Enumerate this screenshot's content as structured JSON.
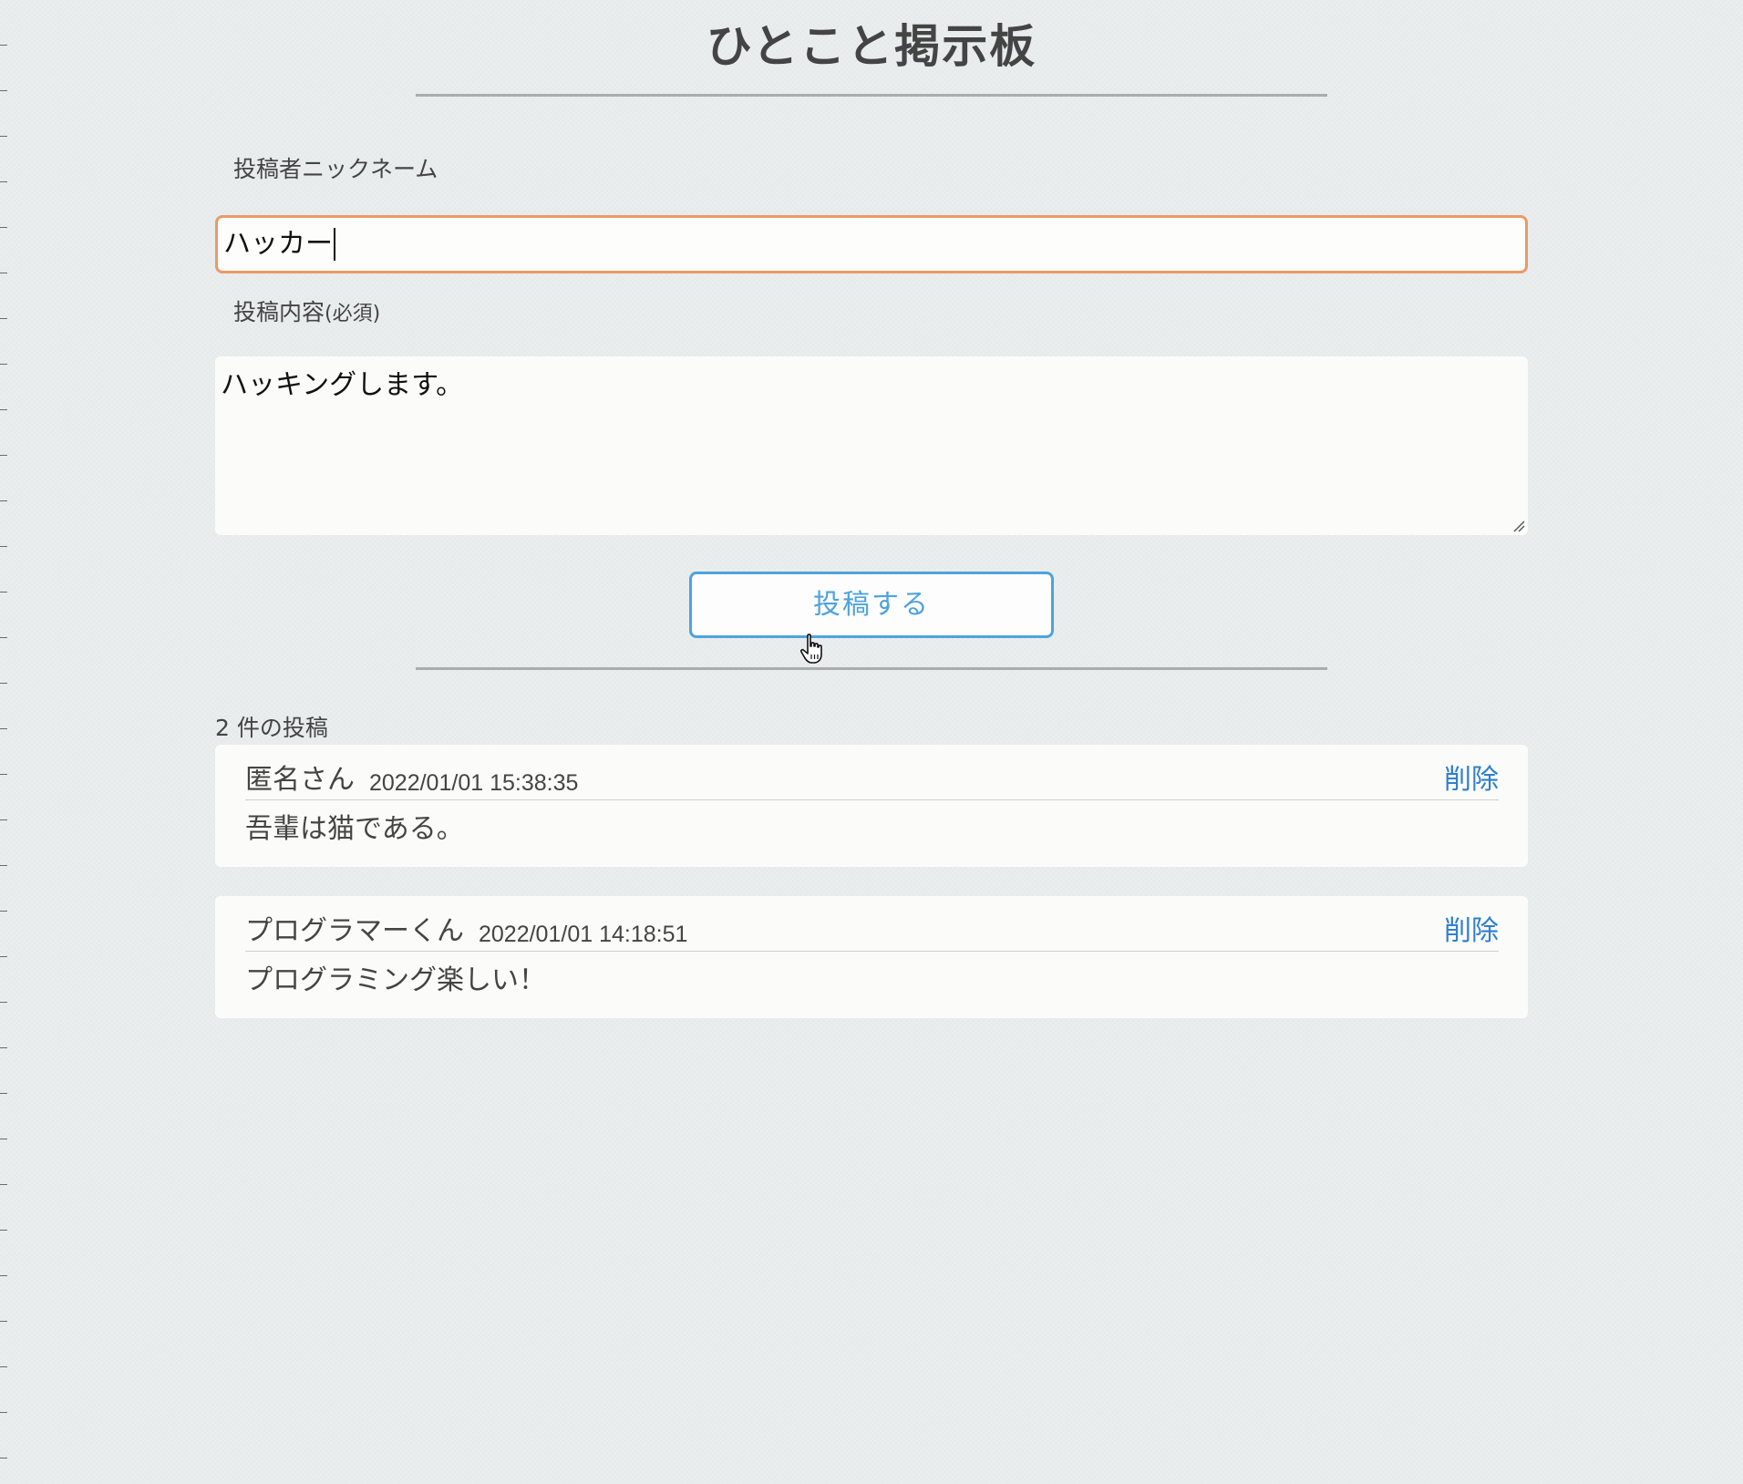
{
  "header": {
    "title": "ひとこと掲示板"
  },
  "form": {
    "nickname_label": "投稿者ニックネーム",
    "nickname_value": "ハッカー",
    "body_label": "投稿内容",
    "body_required": "(必須)",
    "body_value": "ハッキングします。",
    "submit_label": "投稿する"
  },
  "posts": {
    "count_label": "2 件の投稿",
    "items": [
      {
        "name": "匿名さん",
        "time": "2022/01/01 15:38:35",
        "body": "吾輩は猫である。",
        "delete_label": "削除"
      },
      {
        "name": "プログラマーくん",
        "time": "2022/01/01 14:18:51",
        "body": "プログラミング楽しい！",
        "delete_label": "削除"
      }
    ]
  },
  "colors": {
    "background": "#e8ecec",
    "focus_border": "#ea9a68",
    "button_accent": "#4ea3dd",
    "link": "#2f7fcf"
  },
  "icons": {
    "cursor": "hand-pointer-icon",
    "resize": "resize-grip-icon"
  }
}
